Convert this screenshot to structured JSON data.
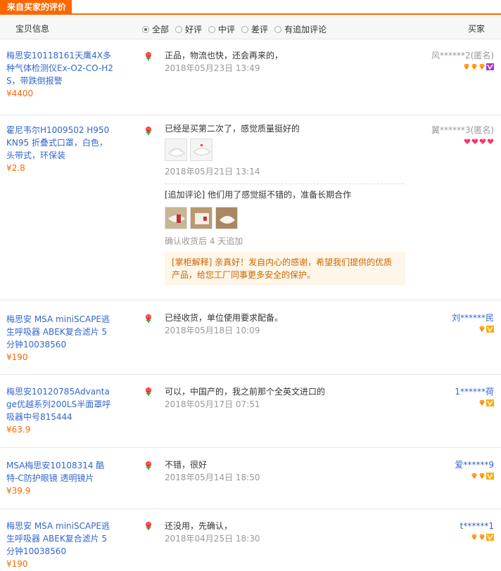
{
  "tab_title": "来自买家的评价",
  "header": {
    "product_col": "宝贝信息",
    "buyer_col": "买家",
    "filters": [
      {
        "label": "全部",
        "checked": true
      },
      {
        "label": "好评",
        "checked": false
      },
      {
        "label": "中评",
        "checked": false
      },
      {
        "label": "差评",
        "checked": false
      },
      {
        "label": "有追加评论",
        "checked": false
      }
    ]
  },
  "reviews": [
    {
      "product": "梅思安10118161天鹰4X多种气体检测仪Ex-O2-CO-H2S，带跌倒报警",
      "price": "¥4400",
      "comment": "正品，物流也快，还会再来的，",
      "date": "2018年05月23日 13:49",
      "buyer": "风******2(匿名)",
      "badge_icons": [
        "diamond-icon",
        "diamond-icon",
        "diamond-icon",
        "vip-purple-icon"
      ]
    },
    {
      "product": "霍尼韦尔H1009502 H950 KN95 折叠式口罩，白色，头带式，环保装",
      "price": "¥2.8",
      "comment": "已经是买第二次了，感觉质量挺好的",
      "date": "2018年05月21日 13:14",
      "buyer": "翼******3(匿名)",
      "badge_icons": [
        "heart-icon",
        "heart-icon",
        "heart-icon",
        "heart-icon"
      ],
      "followup": "[追加评论] 他们用了感觉挺不错的，准备长期合作",
      "followup_note": "确认收货后 4 天追加",
      "seller_reply": "[掌柜解释] 亲真好！发自内心的感谢，希望我们提供的优质产品，给您工厂同事更多安全的保护。"
    },
    {
      "product": "梅思安 MSA miniSCAPE逃生呼吸器 ABEK复合滤片 5分钟10038560",
      "price": "¥190",
      "comment": "已经收货，单位使用要求配备。",
      "date": "2018年05月18日 10:09",
      "buyer": "刘******民",
      "badge_icons": [
        "diamond-icon",
        "vip-gold-icon"
      ]
    },
    {
      "product": "梅思安10120785Advantage优越系列200LS半面罩呼吸器中号815444",
      "price": "¥63.9",
      "comment": "可以，中国产的，我之前那个全英文进口的",
      "date": "2018年05月17日 07:51",
      "buyer": "1******荷",
      "badge_icons": [
        "diamond-icon",
        "vip-gold-icon"
      ]
    },
    {
      "product": "MSA梅思安10108314 酷特-C防护眼镜 透明镜片",
      "price": "¥39.9",
      "comment": "不错，很好",
      "date": "2018年05月14日 18:50",
      "buyer": "爱******9",
      "badge_icons": [
        "diamond-icon",
        "diamond-icon",
        "vip-gold-icon"
      ]
    },
    {
      "product": "梅思安 MSA miniSCAPE逃生呼吸器 ABEK复合滤片 5分钟10038560",
      "price": "¥190",
      "comment": "还没用，先确认，",
      "date": "2018年04月25日 18:30",
      "buyer": "t******1",
      "badge_icons": [
        "diamond-icon",
        "diamond-icon",
        "vip-gold-icon"
      ]
    }
  ],
  "colors": {
    "accent": "#ff6600",
    "link": "#3366cc",
    "price": "#ff6600",
    "reply_bg": "#fdf6e9",
    "reply_text": "#cc6600"
  }
}
